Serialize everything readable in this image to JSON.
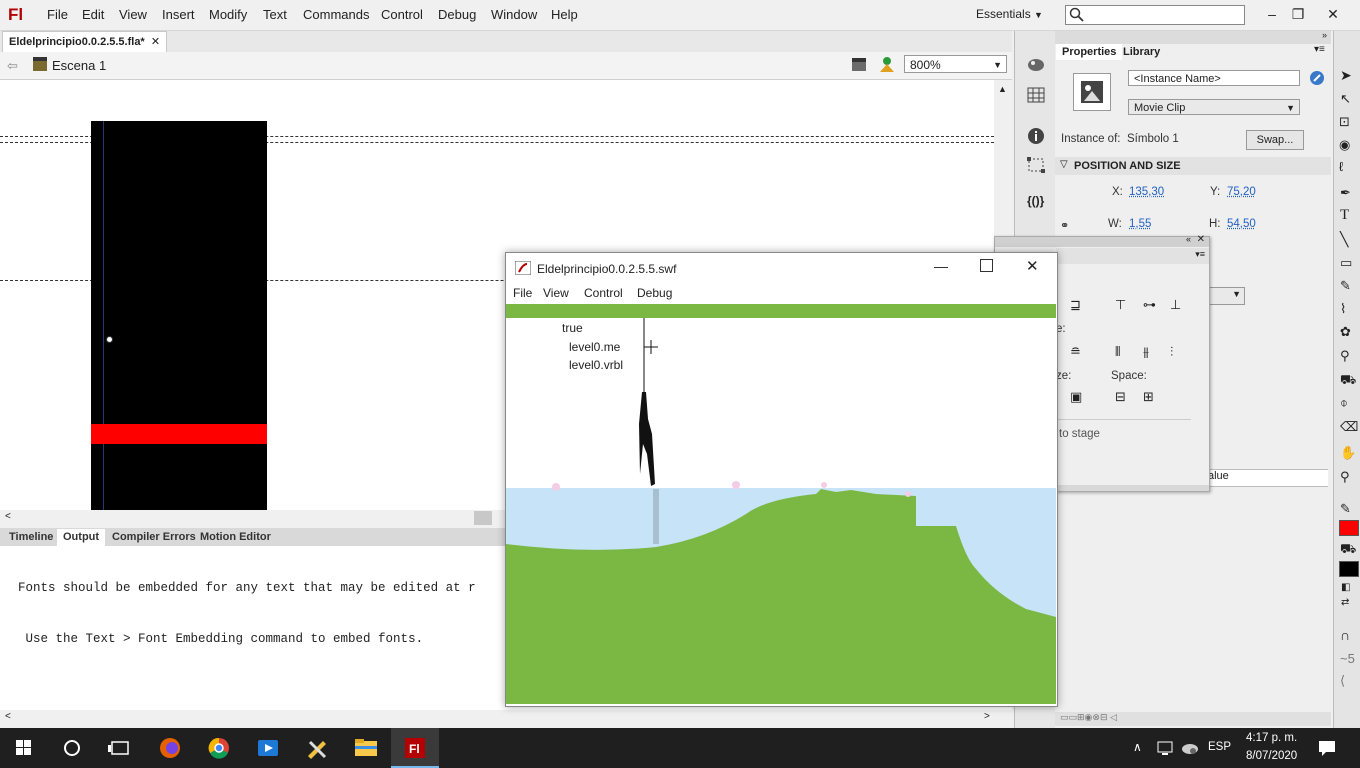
{
  "app": {
    "logo": "Fl",
    "menu": [
      "File",
      "Edit",
      "View",
      "Insert",
      "Modify",
      "Text",
      "Commands",
      "Control",
      "Debug",
      "Window",
      "Help"
    ],
    "workspace": "Essentials",
    "search_placeholder": ""
  },
  "document": {
    "tab_label": "Eldelprincipio0.0.2.5.5.fla*",
    "scene_label": "Escena 1",
    "zoom": "800%"
  },
  "bottom_panel": {
    "tabs": [
      "Timeline",
      "Output",
      "Compiler Errors",
      "Motion Editor"
    ],
    "active_tab": "Output",
    "output_lines": [
      "Fonts should be embedded for any text that may be edited at r",
      " Use the Text > Font Embedding command to embed fonts."
    ]
  },
  "properties": {
    "tabs": [
      "Properties",
      "Library"
    ],
    "instance_name_placeholder": "<Instance Name>",
    "symbol_type": "Movie Clip",
    "instance_of_label": "Instance of:",
    "instance_of_value": "Símbolo 1",
    "swap_label": "Swap...",
    "section_title": "POSITION AND SIZE",
    "x_label": "X:",
    "x_value": "135,30",
    "y_label": "Y:",
    "y_value": "75,20",
    "w_label": "W:",
    "w_value": "1,55",
    "h_label": "H:",
    "h_value": "54,50"
  },
  "align_panel": {
    "partial_label_1": "e:",
    "partial_label_2": "ze:",
    "space_label": "Space:",
    "to_stage_label": "to stage",
    "value_label": "alue"
  },
  "swf_window": {
    "title": "Eldelprincipio0.0.2.5.5.swf",
    "menu": [
      "File",
      "View",
      "Control",
      "Debug"
    ],
    "trace_lines": [
      "true",
      "level0.me",
      "level0.vrbl"
    ]
  },
  "taskbar": {
    "language": "ESP",
    "time": "4:17 p. m.",
    "date": "8/07/2020"
  },
  "colors": {
    "grass": "#7ab843",
    "water": "#c6e3f7",
    "stage_clip": "#000000",
    "red_bar": "#ff0000",
    "link_value": "#2260c0"
  }
}
